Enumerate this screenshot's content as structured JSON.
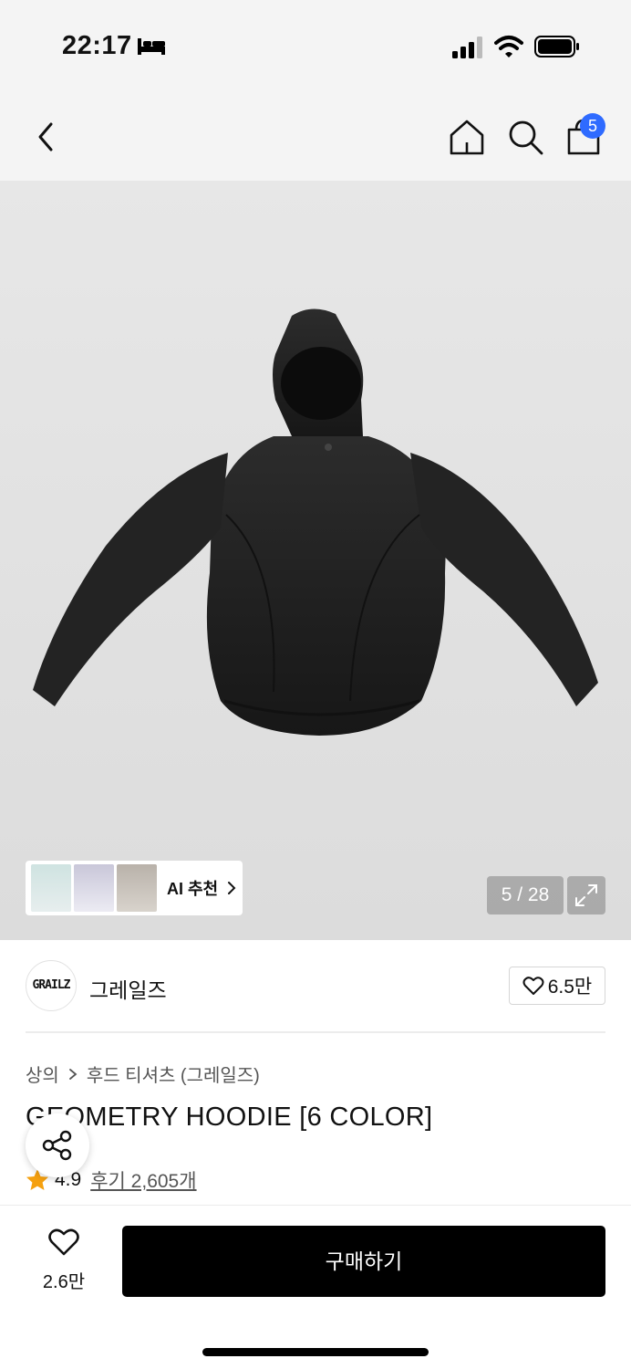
{
  "status_bar": {
    "time": "22:17",
    "icons": [
      "bed-icon",
      "cellular-signal-icon",
      "wifi-icon",
      "battery-icon"
    ]
  },
  "nav": {
    "icons": [
      "back-arrow-icon",
      "home-icon",
      "search-icon",
      "shopping-bag-icon"
    ],
    "cart_badge": "5"
  },
  "gallery": {
    "image": "black-hoodie",
    "ai_recommend_label": "AI 추천",
    "counter": "5 / 28"
  },
  "brand": {
    "logo_text": "GRAILZ",
    "name": "그레일즈",
    "like_count": "6.5만"
  },
  "product": {
    "breadcrumb": [
      "상의",
      "후드 티셔츠 (그레일즈)"
    ],
    "title": "GEOMETRY HOODIE [6 COLOR]",
    "rating": "4.9",
    "review_text": "후기 2,605개"
  },
  "bottom": {
    "like_count": "2.6만",
    "buy_label": "구매하기"
  },
  "colors": {
    "accent_badge": "#2f6bff",
    "star": "#f5a00f",
    "buy_button": "#000000"
  }
}
